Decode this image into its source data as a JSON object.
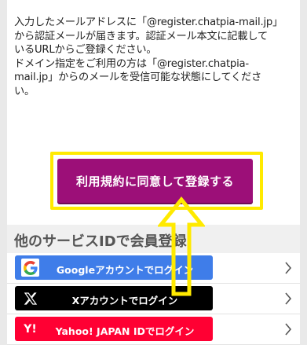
{
  "notice": {
    "line1": "入力したメールアドレスに「@register.chatpia-mail.jp」",
    "line2": "から認証メールが届きます。認証メール本文に記載して",
    "line3": "いるURLからご登録ください。",
    "line4": "ドメイン指定をご利用の方は「@register.chatpia-",
    "line5": "mail.jp」からのメールを受信可能な状態にしてくださ",
    "line6": "い。"
  },
  "agree_button": "利用規約に同意して登録する",
  "section_title": "他のサービスIDで会員登録",
  "services": [
    {
      "label": "Googleアカウントでログイン",
      "icon": "google-icon",
      "color": "#3f7de9"
    },
    {
      "label": "Xアカウントでログイン",
      "icon": "x-logo-icon",
      "color": "#000000"
    },
    {
      "label": "Yahoo! JAPAN IDでログイン",
      "icon": "yahoo-icon",
      "color": "#ff0033"
    }
  ],
  "colors": {
    "agree_button": "#9c0f78",
    "highlight": "#ffea00"
  }
}
